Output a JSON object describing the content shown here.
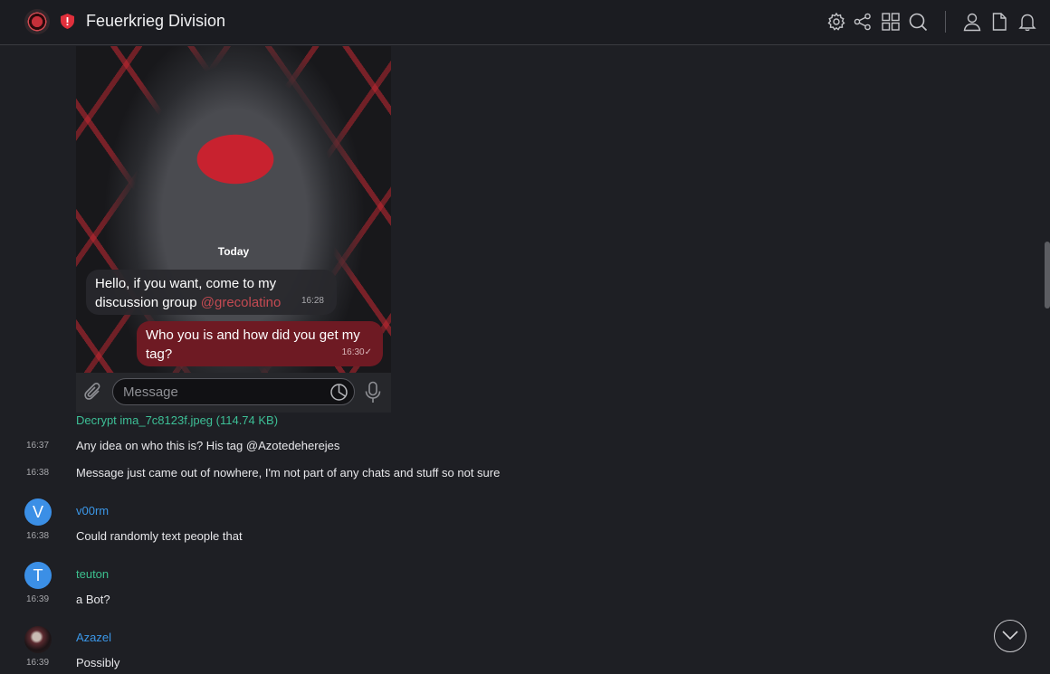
{
  "header": {
    "title": "Feuerkrieg Division",
    "icons": [
      "gear-icon",
      "share-icon",
      "grid-icon",
      "search-icon",
      "user-icon",
      "file-icon",
      "bell-icon"
    ]
  },
  "attachment": {
    "today_label": "Today",
    "incoming": {
      "text": "Hello, if you want, come to my discussion group",
      "handle": "@grecolatino",
      "time": "16:28"
    },
    "outgoing": {
      "text": "Who you is and how did you get my tag?",
      "time": "16:30",
      "check": "✓"
    },
    "composer_placeholder": "Message",
    "file_link": "Decrypt ima_7c8123f.jpeg (114.74 KB)"
  },
  "messages": [
    {
      "time": "16:37",
      "text": "Any idea on who this is? His tag @Azotedeherejes"
    },
    {
      "time": "16:38",
      "text": "Message just came out of nowhere, I'm not part of any chats and stuff so not sure"
    }
  ],
  "posts": [
    {
      "author": "v00rm",
      "initial": "V",
      "color": "#3b97e8",
      "time": "16:38",
      "text": "Could randomly text people that"
    },
    {
      "author": "teuton",
      "initial": "T",
      "color": "#3cbf8e",
      "time": "16:39",
      "text": "a Bot?"
    },
    {
      "author": "Azazel",
      "initial": "",
      "color": "#3b97e8",
      "time": "16:39",
      "text": "Possibly"
    }
  ]
}
